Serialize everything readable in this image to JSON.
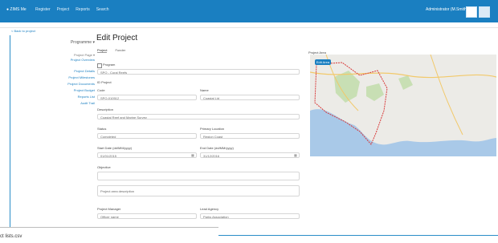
{
  "navbar": {
    "brand": "● ZIMS  Me",
    "items": [
      "Register",
      "Project",
      "Reports",
      "Search"
    ],
    "user": "Administrator (M.Smith)",
    "colors": {
      "bar": "#1a7fc1",
      "accent": "#1a7fc1"
    }
  },
  "breadcrumb": "< Back to project",
  "sidenav": {
    "heading": "Programme ▾",
    "subheading": "Project Page ▾",
    "links": [
      "Project Overview",
      "Project Details",
      "Project Milestones",
      "Project Documents",
      "Project Budget",
      "Reports List",
      "Audit Trail"
    ]
  },
  "page_title": "Edit Project",
  "tabs": [
    "Project",
    "Funder"
  ],
  "form": {
    "program_label": "Program",
    "program_value": "SPO - Coral Reefs",
    "id_label": "ID Project",
    "code_label": "Code",
    "code_value": "SPO-010512",
    "name_label": "Name",
    "name_value": "Coastal Lid",
    "description_label": "Description",
    "description_value": "Coastal Reef and Marine Survey",
    "status_label": "Status",
    "status_value": "Completed",
    "primary_label": "Primary Location",
    "primary_value": "Region Coast",
    "start_label": "Start Date (dd/MM/yyyy)",
    "start_value": "01/01/2015",
    "end_label": "End Date (dd/MM/yyyy)",
    "end_value": "31/12/2016",
    "objective_label": "Objective",
    "objective_value": "",
    "project_desc_value": "Project area description",
    "pm_label": "Project Manager",
    "pm_value": "Officer name",
    "lead_label": "Lead Agency",
    "lead_value": "Parks Association",
    "save_button": ""
  },
  "map": {
    "label": "Project Area",
    "button": "Edit Area",
    "colors": {
      "sea": "#a9c9e8",
      "land": "#ecebe7",
      "park": "#c8dfb4",
      "boundary": "#d83a3a",
      "road": "#f2c96a"
    }
  },
  "overlay_text": "ct lists.csv"
}
